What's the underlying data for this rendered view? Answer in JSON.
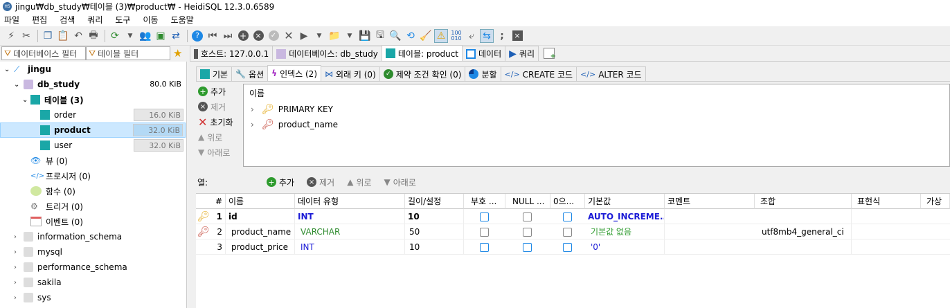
{
  "window": {
    "title": "jingu₩db_study₩테이블 (3)₩product₩ - HeidiSQL 12.3.0.6589"
  },
  "menu": [
    "파일",
    "편집",
    "검색",
    "쿼리",
    "도구",
    "이동",
    "도움말"
  ],
  "filters": {
    "db_placeholder": "데이터베이스 필터",
    "table_placeholder": "테이블 필터"
  },
  "tabs": [
    {
      "label": "호스트: 127.0.0.1"
    },
    {
      "label": "데이터베이스: db_study"
    },
    {
      "label": "테이블: product"
    },
    {
      "label": "데이터"
    },
    {
      "label": "쿼리"
    }
  ],
  "tree": {
    "server": "jingu",
    "database": {
      "name": "db_study",
      "size": "80.0 KiB"
    },
    "tables_group": "테이블 (3)",
    "tables": [
      {
        "name": "order",
        "size": "16.0 KiB"
      },
      {
        "name": "product",
        "size": "32.0 KiB"
      },
      {
        "name": "user",
        "size": "32.0 KiB"
      }
    ],
    "objects": [
      "뷰 (0)",
      "프로시저 (0)",
      "함수 (0)",
      "트리거 (0)",
      "이벤트 (0)"
    ],
    "other_dbs": [
      "information_schema",
      "mysql",
      "performance_schema",
      "sakila",
      "sys"
    ]
  },
  "subtabs": [
    "기본",
    "옵션",
    "인덱스 (2)",
    "외래 키 (0)",
    "제약 조건 확인 (0)",
    "분할",
    "CREATE 코드",
    "ALTER 코드"
  ],
  "index_buttons": [
    "추가",
    "제거",
    "초기화",
    "위로",
    "아래로"
  ],
  "index_panel": {
    "header": "이름",
    "items": [
      "PRIMARY KEY",
      "product_name"
    ]
  },
  "columns_bar": {
    "label": "열:",
    "add": "추가",
    "remove": "제거",
    "up": "위로",
    "down": "아래로"
  },
  "grid": {
    "headers": [
      "#",
      "이름",
      "데이터 유형",
      "길이/설정",
      "부호 ...",
      "NULL ...",
      "0으...",
      "기본값",
      "코멘트",
      "조합",
      "표현식",
      "가상"
    ],
    "rows": [
      {
        "num": "1",
        "name": "id",
        "type": "INT",
        "length": "10",
        "default": "AUTO_INCREME...",
        "collation": ""
      },
      {
        "num": "2",
        "name": "product_name",
        "type": "VARCHAR",
        "length": "50",
        "default": "기본값 없음",
        "collation": "utf8mb4_general_ci"
      },
      {
        "num": "3",
        "name": "product_price",
        "type": "INT",
        "length": "10",
        "default": "'0'",
        "collation": ""
      }
    ]
  },
  "colors": {
    "accent": "#1e88e5",
    "selection": "#cce8ff",
    "int_type": "#1a1ad6",
    "varchar_type": "#2e8b2e",
    "key_primary": "#e0a000",
    "key_unique": "#c0392b"
  }
}
